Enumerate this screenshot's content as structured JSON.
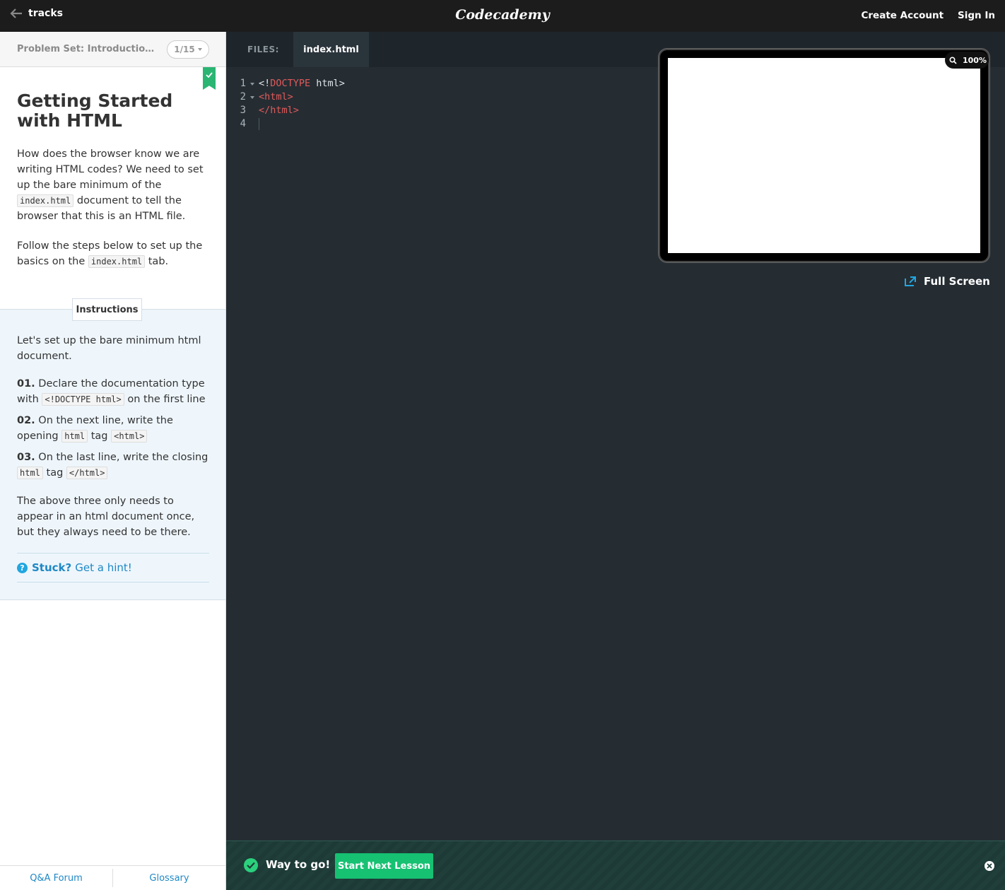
{
  "topbar": {
    "back_label": "tracks",
    "brand": "Codecademy",
    "create_account": "Create Account",
    "sign_in": "Sign In"
  },
  "left": {
    "problem_set": "Problem Set: Introduction to...",
    "pager": "1/15",
    "title": "Getting Started with HTML",
    "desc1_a": "How does the browser know we are writing HTML codes? We need to set up the bare minimum of the ",
    "desc1_code": "index.html",
    "desc1_b": " document to tell the browser that this is an HTML file.",
    "desc2_a": "Follow the steps below to set up the basics on the ",
    "desc2_code": "index.html",
    "desc2_b": " tab.",
    "instructions_tab": "Instructions",
    "instr_intro": "Let's set up the bare minimum html document.",
    "steps": [
      {
        "num": "01.",
        "text_a": " Declare the documentation type with ",
        "code": "<!DOCTYPE html>",
        "text_b": " on the first line"
      },
      {
        "num": "02.",
        "text_a": " On the next line, write the opening ",
        "code1": "html",
        "mid": " tag ",
        "code2": "<html>"
      },
      {
        "num": "03.",
        "text_a": " On the last line, write the closing ",
        "code1": "html",
        "mid": " tag ",
        "code2": "</html>"
      }
    ],
    "instr_outro": "The above three only needs to appear in an html document once, but they always need to be there.",
    "hint_stuck": "Stuck?",
    "hint_get": "Get a hint!",
    "footer_forum": "Q&A Forum",
    "footer_glossary": "Glossary"
  },
  "editor": {
    "files_label": "FILES:",
    "active_tab": "index.html",
    "line_numbers": [
      "1",
      "2",
      "3",
      "4"
    ],
    "lines": {
      "l1_a": "<!",
      "l1_kw": "DOCTYPE",
      "l1_b": " html>",
      "l2": "<html>",
      "l3": "</html>"
    }
  },
  "preview": {
    "zoom": "100%",
    "fullscreen": "Full Screen"
  },
  "success": {
    "message": "Way to go!",
    "next_button": "Start Next Lesson"
  },
  "colors": {
    "accent_green": "#16c172",
    "link_blue": "#1f88c5",
    "editor_bg": "#252d33",
    "keyword_red": "#e05a5a"
  }
}
